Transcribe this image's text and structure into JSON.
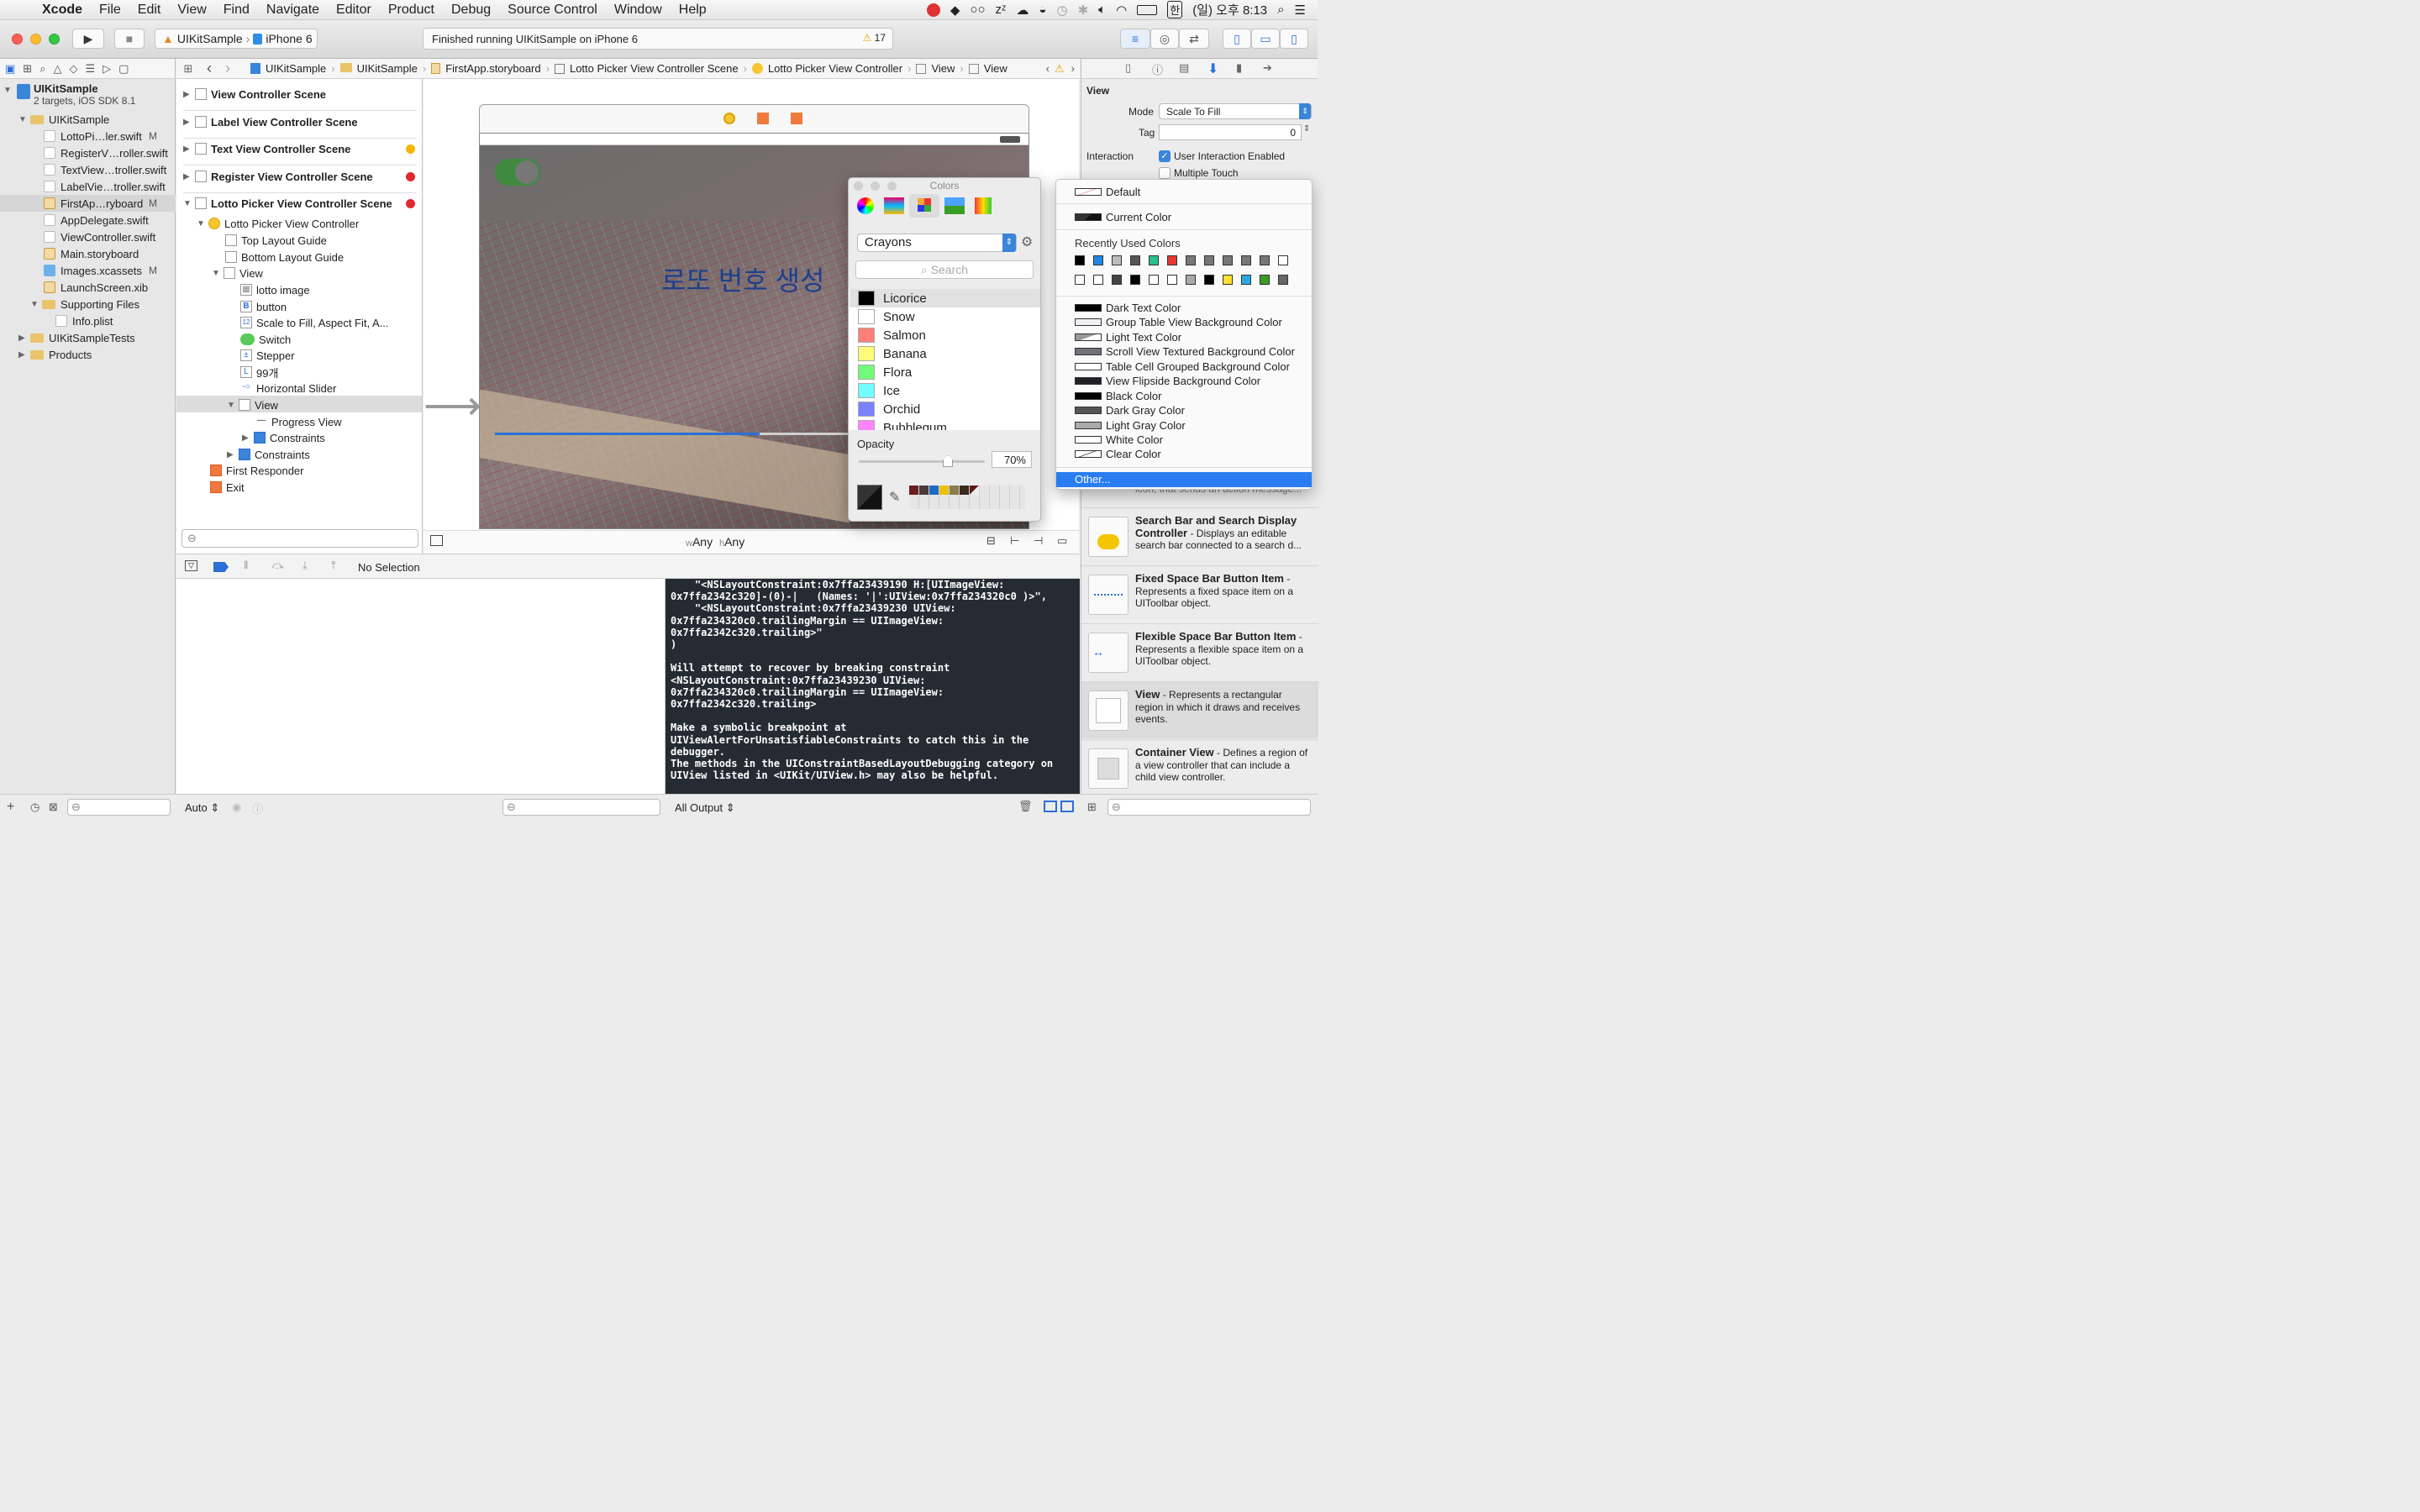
{
  "menubar": {
    "app": "Xcode",
    "items": [
      "File",
      "Edit",
      "View",
      "Find",
      "Navigate",
      "Editor",
      "Product",
      "Debug",
      "Source Control",
      "Window",
      "Help"
    ],
    "status_input": "한",
    "clock": "(일) 오후 8:13"
  },
  "toolbar": {
    "scheme": "UIKitSample",
    "device": "iPhone 6",
    "activity": "Finished running UIKitSample on iPhone 6",
    "warnings": "17"
  },
  "jumpbar": {
    "crumbs": [
      "UIKitSample",
      "UIKitSample",
      "FirstApp.storyboard",
      "Lotto Picker View Controller Scene",
      "Lotto Picker View Controller",
      "View",
      "View"
    ]
  },
  "navigator": {
    "project_name": "UIKitSample",
    "project_sub": "2 targets, iOS SDK 8.1",
    "items": [
      {
        "label": "UIKitSample",
        "badge": ""
      },
      {
        "label": "LottoPi…ler.swift",
        "badge": "M"
      },
      {
        "label": "RegisterV…roller.swift",
        "badge": ""
      },
      {
        "label": "TextView…troller.swift",
        "badge": ""
      },
      {
        "label": "LabelVie…troller.swift",
        "badge": ""
      },
      {
        "label": "FirstAp…ryboard",
        "badge": "M"
      },
      {
        "label": "AppDelegate.swift",
        "badge": ""
      },
      {
        "label": "ViewController.swift",
        "badge": ""
      },
      {
        "label": "Main.storyboard",
        "badge": ""
      },
      {
        "label": "Images.xcassets",
        "badge": "M"
      },
      {
        "label": "LaunchScreen.xib",
        "badge": ""
      },
      {
        "label": "Supporting Files",
        "badge": ""
      },
      {
        "label": "Info.plist",
        "badge": ""
      },
      {
        "label": "UIKitSampleTests",
        "badge": ""
      },
      {
        "label": "Products",
        "badge": ""
      }
    ]
  },
  "outline": {
    "scenes": [
      "View Controller Scene",
      "Label View Controller Scene",
      "Text View Controller Scene",
      "Register View Controller Scene",
      "Lotto Picker View Controller Scene"
    ],
    "items": [
      "Lotto Picker View Controller",
      "Top Layout Guide",
      "Bottom Layout Guide",
      "View",
      "lotto image",
      "button",
      "Scale to Fill, Aspect Fit, A...",
      "Switch",
      "Stepper",
      "99개",
      "Horizontal Slider",
      "View",
      "Progress View",
      "Constraints",
      "Constraints",
      "First Responder",
      "Exit"
    ]
  },
  "canvas": {
    "title_text": "로또 번호 생성",
    "size_w": "Any",
    "size_h": "Any",
    "w_prefix": "w",
    "h_prefix": "h"
  },
  "debug": {
    "selection": "No Selection",
    "console_text": "    \"<NSLayoutConstraint:0x7ffa23439190 H:[UIImageView:\n0x7ffa2342c320]-(0)-|   (Names: '|':UIView:0x7ffa234320c0 )>\",\n    \"<NSLayoutConstraint:0x7ffa23439230 UIView:\n0x7ffa234320c0.trailingMargin == UIImageView:\n0x7ffa2342c320.trailing>\"\n)\n\nWill attempt to recover by breaking constraint\n<NSLayoutConstraint:0x7ffa23439230 UIView:\n0x7ffa234320c0.trailingMargin == UIImageView:\n0x7ffa2342c320.trailing>\n\nMake a symbolic breakpoint at\nUIViewAlertForUnsatisfiableConstraints to catch this in the\ndebugger.\nThe methods in the UIConstraintBasedLayoutDebugging category on\nUIView listed in <UIKit/UIView.h> may also be helpful.",
    "auto_label": "Auto",
    "output_label": "All Output"
  },
  "inspector": {
    "section": "View",
    "mode_label": "Mode",
    "mode_value": "Scale To Fill",
    "tag_label": "Tag",
    "tag_value": "0",
    "interaction_label": "Interaction",
    "user_interaction": "User Interaction Enabled",
    "multiple_touch": "Multiple Touch",
    "library": [
      {
        "title": "Search Bar and Search Display Controller",
        "desc": " - Displays an editable search bar connected to a search d..."
      },
      {
        "title": "Fixed Space Bar Button Item",
        "desc": " - Represents a fixed space item on a UIToolbar object."
      },
      {
        "title": "Flexible Space Bar Button Item",
        "desc": " - Represents a flexible space item on a UIToolbar object."
      },
      {
        "title": "View",
        "desc": " - Represents a rectangular region in which it draws and receives events."
      },
      {
        "title": "Container View",
        "desc": " - Defines a region of a view controller that can include a child view controller."
      }
    ],
    "partial_text": "icon, that sends an action message..."
  },
  "colors_panel": {
    "title": "Colors",
    "palette": "Crayons",
    "search_placeholder": "Search",
    "crayons": [
      {
        "name": "Licorice",
        "color": "#000000"
      },
      {
        "name": "Snow",
        "color": "#ffffff"
      },
      {
        "name": "Salmon",
        "color": "#ff7e79"
      },
      {
        "name": "Banana",
        "color": "#fffc79"
      },
      {
        "name": "Flora",
        "color": "#73fa79"
      },
      {
        "name": "Ice",
        "color": "#73fdff"
      },
      {
        "name": "Orchid",
        "color": "#7a81ff"
      },
      {
        "name": "Bubblegum",
        "color": "#ff85ff"
      }
    ],
    "opacity_label": "Opacity",
    "opacity_value": "70%",
    "opacity_fraction": 0.7
  },
  "color_menu": {
    "default": "Default",
    "current": "Current Color",
    "recent_header": "Recently Used Colors",
    "recent_row1": [
      "#000000",
      "#1e88e5",
      "#bdbdbd",
      "#555555",
      "#27c08b",
      "#e53935",
      "#777777",
      "#777777",
      "#777777",
      "#777777",
      "#777777",
      "#ffffff"
    ],
    "recent_row2": [
      "#ffffff",
      "#ffffff",
      "#444444",
      "#000000",
      "#ffffff",
      "#ffffff",
      "#aaaaaa",
      "#000000",
      "#ffe033",
      "#29a9e0",
      "#3a9d23",
      "#666666"
    ],
    "named": [
      {
        "label": "Dark Text Color",
        "color": "#000000"
      },
      {
        "label": "Group Table View Background Color",
        "color": "#efeff4"
      },
      {
        "label": "Light Text Color",
        "color": "#999999"
      },
      {
        "label": "Scroll View Textured Background Color",
        "color": "#6f7179"
      },
      {
        "label": "Table Cell Grouped Background Color",
        "color": "#ffffff"
      },
      {
        "label": "View Flipside Background Color",
        "color": "#1f2124"
      },
      {
        "label": "Black Color",
        "color": "#000000"
      },
      {
        "label": "Dark Gray Color",
        "color": "#555555"
      },
      {
        "label": "Light Gray Color",
        "color": "#aaaaaa"
      },
      {
        "label": "White Color",
        "color": "#ffffff"
      },
      {
        "label": "Clear Color",
        "color": "#ffffff"
      }
    ],
    "other": "Other..."
  },
  "icons": {
    "play": "▶",
    "stop": "■",
    "warning": "⚠",
    "gear": "⚙",
    "search": "⌕",
    "back": "‹",
    "forward": "›"
  }
}
